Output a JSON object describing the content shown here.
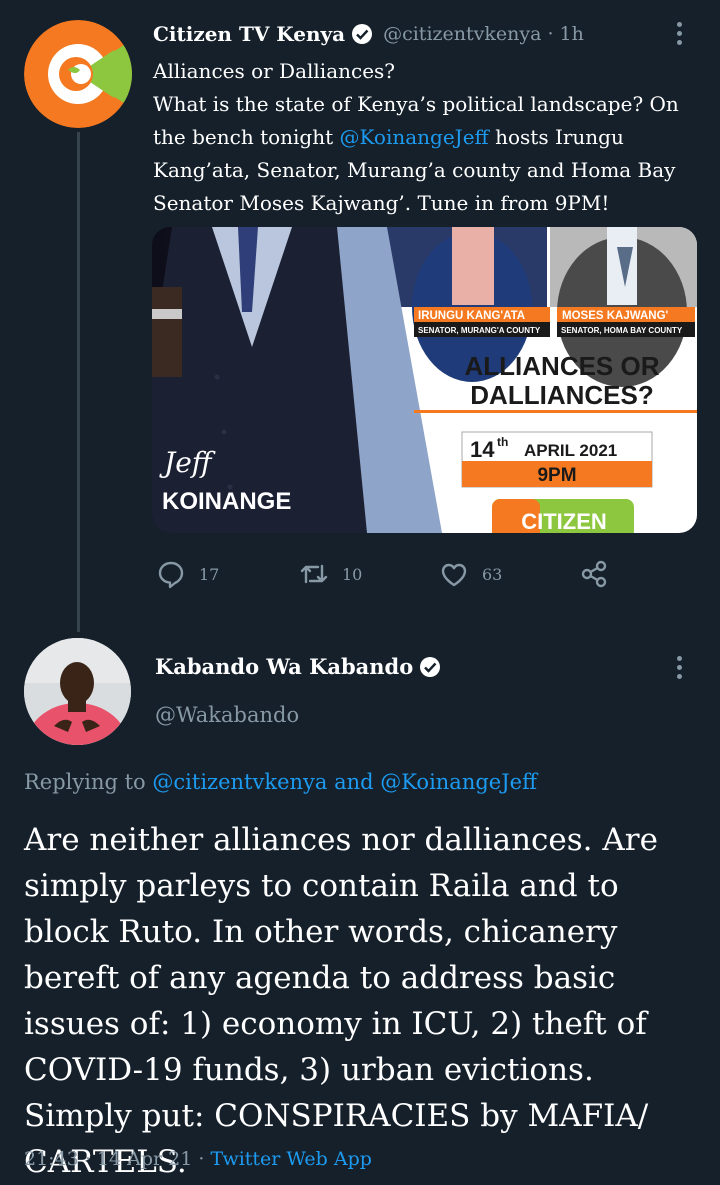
{
  "tweet": {
    "author_name": "Citizen TV Kenya",
    "author_handle": "@citizentvkenya",
    "time_ago": "1h",
    "separator": "·",
    "text_line1": "Alliances or Dalliances?",
    "text_pre": "What is the state of Kenya’s political landscape? On the bench tonight ",
    "mention": "@KoinangeJeff",
    "text_post": " hosts Irungu Kang’ata, Senator, Murang’a county and Homa Bay Senator Moses Kajwang’. Tune in from 9PM!",
    "media": {
      "host_first": "Jeff",
      "host_last": "KOINANGE",
      "guest1_name": "IRUNGU KANG'ATA",
      "guest1_title": "SENATOR, MURANG'A COUNTY",
      "guest2_name": "MOSES KAJWANG'",
      "guest2_title": "SENATOR, HOMA BAY COUNTY",
      "headline1": "ALLIANCES OR",
      "headline2": "DALLIANCES?",
      "date_day": "14",
      "date_suffix": "th",
      "date_rest": "APRIL 2021",
      "time": "9PM",
      "brand": "CITIZEN"
    },
    "counts": {
      "replies": "17",
      "retweets": "10",
      "likes": "63"
    }
  },
  "reply": {
    "author_name": "Kabando Wa Kabando",
    "author_handle": "@Wakabando",
    "replying_label": "Replying to",
    "replying_user1": "@citizentvkenya",
    "replying_and": "and",
    "replying_user2": "@KoinangeJeff",
    "text": "Are neither alliances nor dalliances. Are simply parleys to contain Raila and to block Ruto. In other words, chicanery bereft  of any agenda to address basic issues of: 1) economy in ICU, 2) theft of COVID-19 funds, 3) urban evictions. Simply put: CONSPIRACIES by MAFIA/ CARTELS.",
    "time": "21:43",
    "date": "14 Apr 21",
    "separator": "·",
    "source": "Twitter Web App"
  },
  "colors": {
    "background": "#15202b",
    "accent": "#1d9bf0",
    "muted": "#8899a6",
    "citizen_orange": "#f47920",
    "citizen_green": "#8dc63f"
  },
  "icons": [
    "verified-badge-icon",
    "more-icon",
    "reply-icon",
    "retweet-icon",
    "like-icon",
    "share-icon"
  ]
}
